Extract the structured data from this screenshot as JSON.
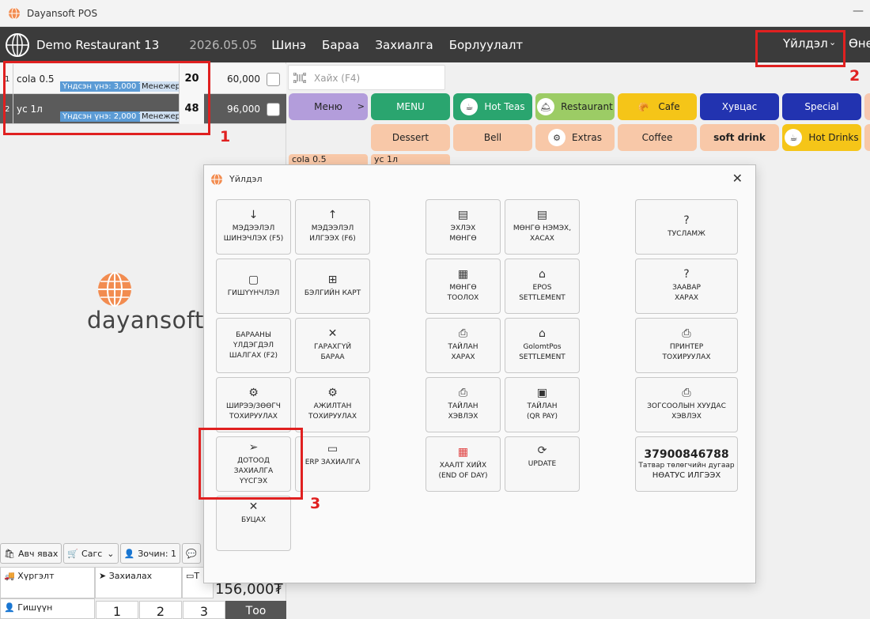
{
  "window": {
    "title": "Dayansoft POS"
  },
  "topnav": {
    "restaurant": "Demo Restaurant 13",
    "date": "2026.05.05",
    "items": [
      "Шинэ",
      "Бараа",
      "Захиалга",
      "Борлуулалт"
    ],
    "action_menu": "Үйлдэл",
    "cut_item": "Өне"
  },
  "order": {
    "rows": [
      {
        "index": "1",
        "name": "cola 0.5",
        "base_price": "Үндсэн үнэ: 3,000 ₮",
        "manager": "Менежер",
        "qty": "20",
        "price": "60,000"
      },
      {
        "index": "2",
        "name": "ус 1л",
        "base_price": "Үндсэн үнэ: 2,000 ₮",
        "manager": "Менежер",
        "qty": "48",
        "price": "96,000"
      }
    ]
  },
  "brand": {
    "name": "dayansoft"
  },
  "bottom": {
    "tabs": [
      "Авч явах",
      "Сагс",
      "Зочин: 1"
    ],
    "grid": {
      "delivery": "Хүргэлт",
      "order": "Захиалах",
      "member": "Гишүүн",
      "t": "Т"
    },
    "total": "156,000₮",
    "keys": [
      "1",
      "2",
      "3"
    ],
    "too": "Тоо"
  },
  "search": {
    "placeholder": "Хайх (F4)"
  },
  "categories": {
    "menu": "Меню",
    "MENU": "MENU",
    "hot_teas": "Hot Teas",
    "restaurant": "Restaurant",
    "cafe": "Cafe",
    "khuvtsas": "Хувцас",
    "special": "Special",
    "dessert": "Dessert",
    "bell": "Bell",
    "extras": "Extras",
    "coffee": "Coffee",
    "soft_drink": "soft drink",
    "hot_drinks": "Hot Drinks"
  },
  "recent_items": [
    "cola 0.5",
    "ус 1л"
  ],
  "annotations": [
    "1",
    "2",
    "3"
  ],
  "dialog": {
    "title": "Үйлдэл",
    "tiles": {
      "info_refresh": "МЭДЭЭЛЭЛ\nШИНЭЧЛЭХ (F5)",
      "info_send": "МЭДЭЭЛЭЛ\nИЛГЭЭХ (F6)",
      "membership": "ГИШҮҮНЧЛЭЛ",
      "gift_card": "БЭЛГИЙН КАРТ",
      "stock_check": "БАРААНЫ\nҮЛДЭГДЭЛ\nШАЛГАХ (F2)",
      "out_of_stock": "ГАРАХГҮЙ\nБАРАА",
      "table_settings": "ШИРЭЭ/ЗӨӨГЧ\nТОХИРУУЛАХ",
      "staff_settings": "АЖИЛТАН\nТОХИРУУЛАХ",
      "internal_order": "ДОТООД\nЗАХИАЛГА\nҮҮСГЭХ",
      "erp_order": "ERP ЗАХИАЛГА",
      "back": "БУЦАХ",
      "start_cash": "ЭХЛЭХ\nМӨНГӨ",
      "cash_add": "МӨНГӨ НЭМЭХ,\nХАСАХ",
      "cash_count": "МӨНГӨ\nТООЛОХ",
      "epos": "EPOS\nSETTLEMENT",
      "report_view": "ТАЙЛАН\nХАРАХ",
      "golomt": "GolomtPos\nSETTLEMENT",
      "report_print": "ТАЙЛАН\nХЭВЛЭХ",
      "report_qr": "ТАЙЛАН\n(QR PAY)",
      "end_of_day": "ХААЛТ ХИЙХ\n(END OF DAY)",
      "update": "UPDATE",
      "help": "ТУСЛАМЖ",
      "guide": "ЗААВАР\nХАРАХ",
      "printer": "ПРИНТЕР\nТОХИРУУЛАХ",
      "stop_print": "ЗОГСООЛЫН ХУУДАС\nХЭВЛЭХ",
      "phone": "37900846788",
      "phone_sub": "Татвар төлөгчийн дугаар",
      "nstatus": "НӨАТУС ИЛГЭЭХ"
    }
  }
}
